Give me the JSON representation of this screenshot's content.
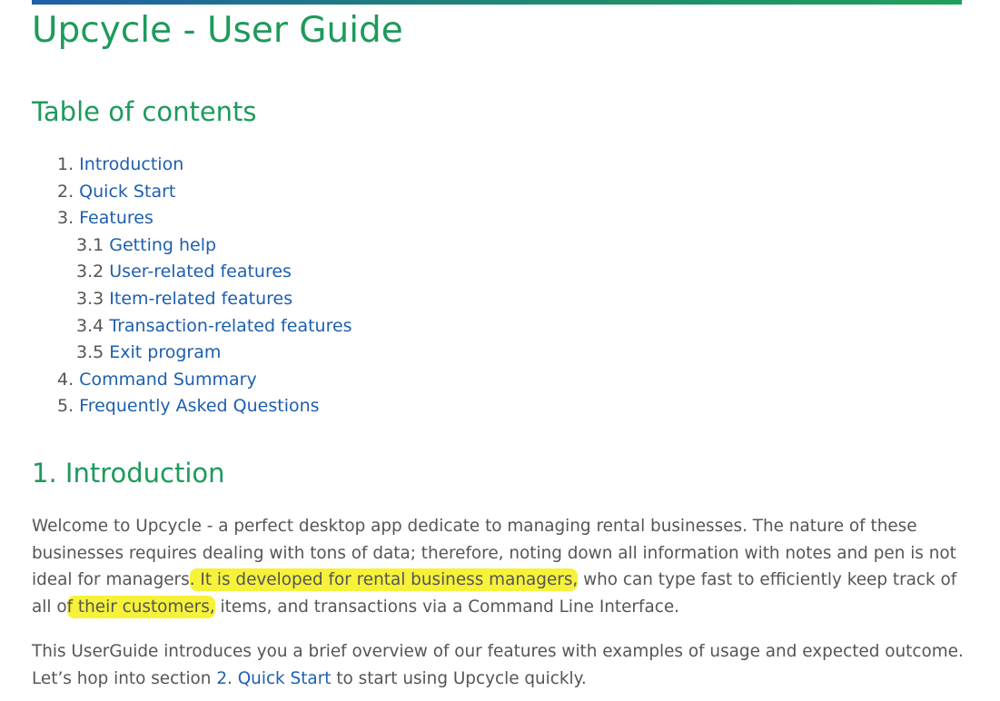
{
  "doc": {
    "title": "Upcycle - User Guide",
    "toc_heading": "Table of contents",
    "toc": [
      {
        "num": "1.",
        "label": "Introduction"
      },
      {
        "num": "2.",
        "label": "Quick Start"
      },
      {
        "num": "3.",
        "label": "Features"
      },
      {
        "num": "3.1",
        "label": "Getting help"
      },
      {
        "num": "3.2",
        "label": "User-related features"
      },
      {
        "num": "3.3",
        "label": "Item-related features"
      },
      {
        "num": "3.4",
        "label": "Transaction-related features"
      },
      {
        "num": "3.5",
        "label": "Exit program"
      },
      {
        "num": "4.",
        "label": "Command Summary"
      },
      {
        "num": "5.",
        "label": "Frequently Asked Questions"
      }
    ],
    "intro_heading": "1. Introduction",
    "intro_p1": {
      "l1": "Welcome to Upcycle - a perfect desktop app dedicate to managing rental businesses. The nature of these",
      "l2": "businesses requires dealing with tons of data; therefore, noting down all information with notes and pen is not",
      "l3a": "ideal for managers",
      "l3_hl": ". It is developed for rental business managers,",
      "l3b": " who can type fast to efficiently keep track of",
      "l4a": "all o",
      "l4_hl": "f their customers,",
      "l4b": " items, and transactions via a Command Line Interface."
    },
    "intro_p2": {
      "l1": "This UserGuide introduces you a brief overview of our features with examples of usage and expected outcome.",
      "l2a": "Let’s hop into section ",
      "l2_link": "2. Quick Start",
      "l2b": " to start using Upcycle quickly."
    }
  },
  "colors": {
    "heading": "#1d9a5b",
    "link": "#1d5fae",
    "text": "#555555",
    "highlight": "#f6f23a"
  }
}
